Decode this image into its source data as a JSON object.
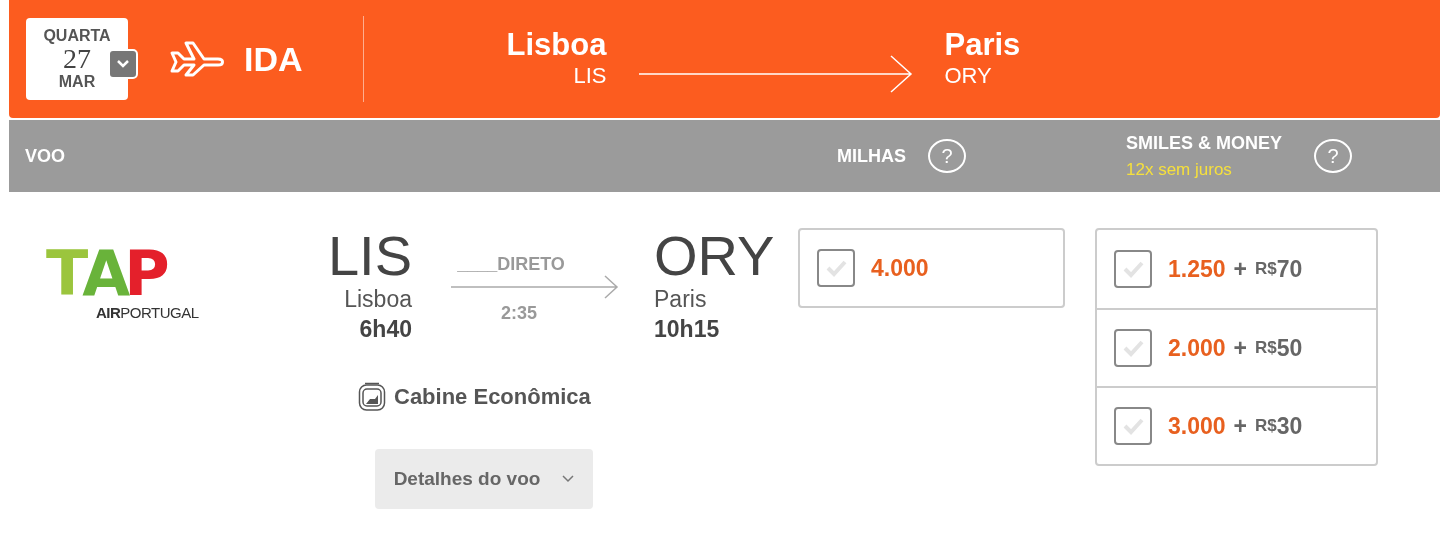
{
  "header": {
    "date": {
      "weekday": "QUARTA",
      "day": "27",
      "month": "MAR"
    },
    "direction": "IDA",
    "origin": {
      "city": "Lisboa",
      "code": "LIS"
    },
    "destination": {
      "city": "Paris",
      "code": "ORY"
    }
  },
  "columns": {
    "flight": "VOO",
    "miles": "MILHAS",
    "smiles": "SMILES & MONEY",
    "installments": "12x sem juros",
    "miles_help": "?",
    "smiles_help": "?"
  },
  "flight": {
    "logo": {
      "letters": [
        "T",
        "A",
        "P"
      ],
      "subtitle": "**AIR**PORTUGAL"
    },
    "departure": {
      "code": "LIS",
      "city": "Lisboa",
      "time": "6h40"
    },
    "stops": "____DIRETO",
    "duration": "2:35",
    "arrival": {
      "code": "ORY",
      "city": "Paris",
      "time": "10h15"
    },
    "cabin": "Cabine Econômica",
    "details_button": "Detalhes do voo"
  },
  "miles_options": [
    {
      "miles": "4.000",
      "checked": false
    }
  ],
  "smiles_options": [
    {
      "miles": "1.250",
      "plus": "+",
      "currency": "R$",
      "amount": "70",
      "checked": false
    },
    {
      "miles": "2.000",
      "plus": "+",
      "currency": "R$",
      "amount": "50",
      "checked": false
    },
    {
      "miles": "3.000",
      "plus": "+",
      "currency": "R$",
      "amount": "30",
      "checked": false
    }
  ]
}
